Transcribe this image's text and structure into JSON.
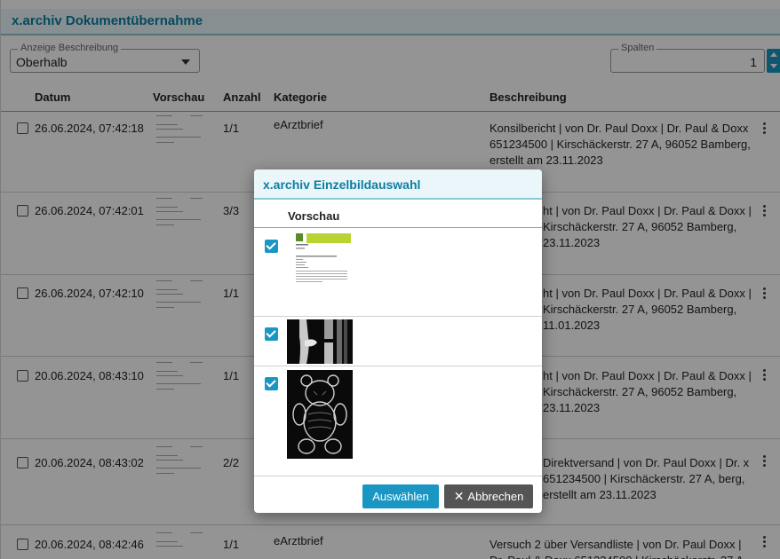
{
  "window": {
    "title": "x.archiv Dokumentübernahme"
  },
  "controls": {
    "anzeige_label": "Anzeige Beschreibung",
    "anzeige_value": "Oberhalb",
    "spalten_label": "Spalten",
    "spalten_value": "1"
  },
  "table": {
    "headers": {
      "datum": "Datum",
      "vorschau": "Vorschau",
      "anzahl": "Anzahl",
      "kategorie": "Kategorie",
      "beschreibung": "Beschreibung"
    },
    "rows": [
      {
        "datum": "26.06.2024, 07:42:18",
        "anzahl": "1/1",
        "kategorie": "eArztbrief",
        "beschreibung": "Konsilbericht | von Dr. Paul Doxx | Dr. Paul & Doxx 651234500 | Kirschäckerstr. 27 A, 96052 Bamberg, erstellt am 23.11.2023"
      },
      {
        "datum": "26.06.2024, 07:42:01",
        "anzahl": "3/3",
        "kategorie": "",
        "beschreibung": "ht | von Dr. Paul Doxx | Dr. Paul & Doxx | Kirschäckerstr. 27 A, 96052 Bamberg, 23.11.2023"
      },
      {
        "datum": "26.06.2024, 07:42:10",
        "anzahl": "1/1",
        "kategorie": "",
        "beschreibung": "ht | von Dr. Paul Doxx | Dr. Paul & Doxx | Kirschäckerstr. 27 A, 96052 Bamberg, 11.01.2023"
      },
      {
        "datum": "20.06.2024, 08:43:10",
        "anzahl": "1/1",
        "kategorie": "",
        "beschreibung": "ht | von Dr. Paul Doxx | Dr. Paul & Doxx | Kirschäckerstr. 27 A, 96052 Bamberg, 23.11.2023"
      },
      {
        "datum": "20.06.2024, 08:43:02",
        "anzahl": "2/2",
        "kategorie": "",
        "beschreibung": "Direktversand | von Dr. Paul Doxx | Dr. x 651234500 | Kirschäckerstr. 27 A, berg, erstellt am 23.11.2023"
      },
      {
        "datum": "20.06.2024, 08:42:46",
        "anzahl": "1/1",
        "kategorie": "eArztbrief",
        "beschreibung": "Versuch 2 über Versandliste | von Dr. Paul Doxx | Dr. Paul & Doxx 651234500 | Kirschäckerstr. 27 A,"
      }
    ]
  },
  "dialog": {
    "title": "x.archiv Einzelbildauswahl",
    "column_header": "Vorschau",
    "items": [
      {
        "type": "document",
        "checked": true
      },
      {
        "type": "xray-knee",
        "checked": true
      },
      {
        "type": "xray-teddy",
        "checked": true
      }
    ],
    "ok_label": "Auswählen",
    "cancel_label": "Abbrechen"
  },
  "colors": {
    "accent": "#1a96c2",
    "title_text": "#0d7ea3",
    "title_bg": "#eaf6f9"
  }
}
